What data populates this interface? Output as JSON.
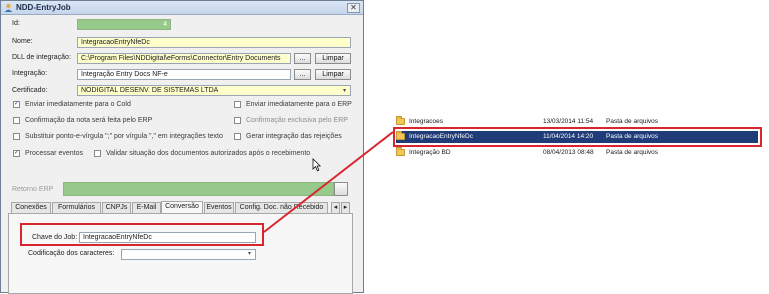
{
  "window": {
    "title": "NDD-EntryJob",
    "close_label": "✕"
  },
  "form": {
    "id_label": "Id:",
    "id_value": "4",
    "nome_label": "Nome:",
    "nome_value": "IntegracaoEntryNfeDc",
    "dll_label": "DLL de integração:",
    "dll_value": "C:\\Program Files\\NDDigital\\eForms\\Connector\\Entry Documents",
    "integracao_label": "Integração:",
    "integracao_value": "Integração Entry Docs NF-e",
    "certificado_label": "Certificado:",
    "certificado_value": "NODIGITAL DESENV. DE SISTEMAS LTDA",
    "browse_label": "...",
    "clear_label": "Limpar",
    "retorno_label": "Retorno ERP"
  },
  "checkboxes": {
    "cold": {
      "label": "Enviar imediatamente para o Cold",
      "checked": true
    },
    "erp": {
      "label": "Enviar imediatamente para o ERP",
      "checked": false
    },
    "confirmacao_nota": {
      "label": "Confirmação da nota será feita pelo ERP",
      "checked": false
    },
    "confirmacao_exclusiva": {
      "label": "Confirmação exclusiva pelo ERP",
      "checked": false
    },
    "substituir": {
      "label": "Substituir ponto-e-vírgula \";\" por vírgula \",\" em integrações texto",
      "checked": false
    },
    "gerar": {
      "label": "Gerar integração das rejeições",
      "checked": false
    },
    "processar": {
      "label": "Processar eventos",
      "checked": true
    },
    "validar": {
      "label": "Validar situação dos documentos autorizados após o recebimento",
      "checked": false
    }
  },
  "tabs": [
    {
      "label": "Conexões"
    },
    {
      "label": "Formulários"
    },
    {
      "label": "CNPJs"
    },
    {
      "label": "E-Mail"
    },
    {
      "label": "Conversão"
    },
    {
      "label": "Eventos"
    },
    {
      "label": "Config. Doc. não Recebido"
    }
  ],
  "tab_scroll": {
    "left": "◂",
    "right": "▸"
  },
  "conversao": {
    "chave_label": "Chave do Job:",
    "chave_value": "IntegracaoEntryNfeDc",
    "codificacao_label": "Codificação dos caracteres:",
    "codificacao_value": ""
  },
  "explorer": {
    "rows": [
      {
        "name": "Integracoes",
        "date": "13/03/2014 11:54",
        "type": "Pasta de arquivos",
        "selected": false
      },
      {
        "name": "IntegracaoEntryNfeDc",
        "date": "11/04/2014 14:20",
        "type": "Pasta de arquivos",
        "selected": true
      },
      {
        "name": "Integração BD",
        "date": "08/04/2013 08:48",
        "type": "Pasta de arquivos",
        "selected": false
      }
    ]
  },
  "colors": {
    "highlight": "#d9262e",
    "selection": "#1f3b78",
    "accent_green": "#96c98a",
    "input_yellow": "#ffffcc"
  },
  "icons": {
    "window": "user-icon",
    "folder": "folder-icon",
    "cursor": "mouse-pointer-icon",
    "dropdown": "chevron-down-icon"
  }
}
